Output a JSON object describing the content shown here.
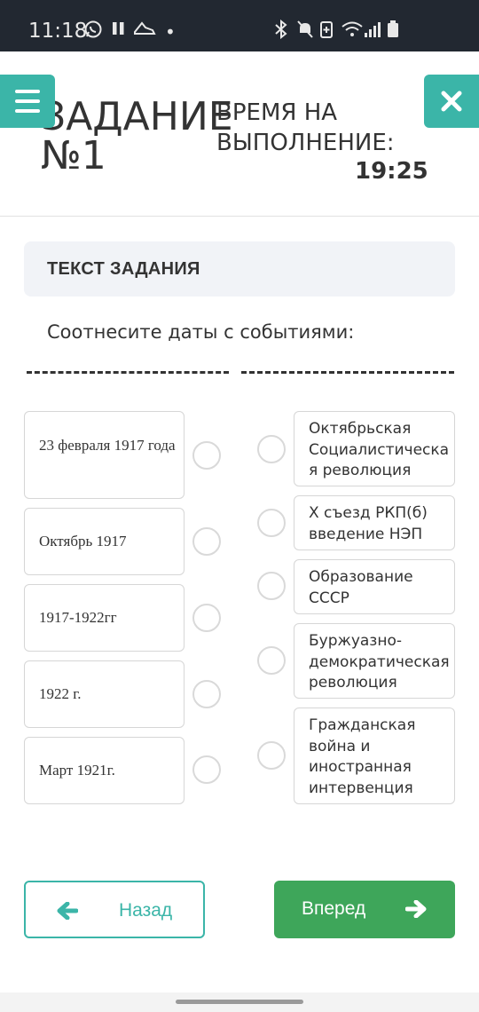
{
  "status_bar": {
    "time": "11:18",
    "left_icons": [
      "whatsapp-icon",
      "pause-icon",
      "shoe-icon",
      "dot-icon"
    ],
    "right_icons": [
      "bluetooth-icon",
      "mute-icon",
      "battery-saver-icon",
      "wifi-icon",
      "signal-icon",
      "battery-icon"
    ]
  },
  "header": {
    "title": "ЗАДАНИЕ №1",
    "time_label": "ВРЕМЯ НА ВЫПОЛНЕНИЕ:",
    "time_value": "19:25"
  },
  "task": {
    "section_title": "ТЕКСТ ЗАДАНИЯ",
    "instruction": "Соотнесите даты с событиями:"
  },
  "dates": [
    {
      "label": "23 февраля 1917 года"
    },
    {
      "label": "Октябрь 1917"
    },
    {
      "label": "1917-1922гг"
    },
    {
      "label": "1922 г."
    },
    {
      "label": "Март 1921г."
    }
  ],
  "events": [
    {
      "label": "Октябрьская Социалистическа я революция"
    },
    {
      "label": "Х съезд РКП(б) введение НЭП"
    },
    {
      "label": "Образование СССР"
    },
    {
      "label": "Буржуазно-демократическая революция"
    },
    {
      "label": "Гражданская война и иностранная интервенция"
    }
  ],
  "navigation": {
    "back_label": "Назад",
    "next_label": "Вперед"
  },
  "colors": {
    "accent": "#3bb5a8",
    "primary_button": "#3ea65a",
    "status_bar": "#222831",
    "task_box": "#f1f3f7"
  }
}
